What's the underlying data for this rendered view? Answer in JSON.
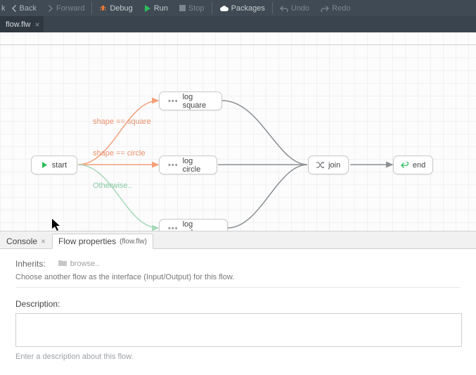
{
  "toolbar": {
    "back": "Back",
    "forward": "Forward",
    "debug": "Debug",
    "run": "Run",
    "stop": "Stop",
    "packages": "Packages",
    "undo": "Undo",
    "redo": "Redo"
  },
  "tabs": {
    "file": "flow.flw"
  },
  "nodes": {
    "start": "start",
    "log_square": "log square",
    "log_circle": "log circle",
    "log_unknown": "log unknown",
    "join": "join",
    "end": "end"
  },
  "edges": {
    "square": "shape == square",
    "circle": "shape == circle",
    "otherwise": "Otherwise.."
  },
  "panel": {
    "console": "Console",
    "flowprops": "Flow properties",
    "flowprops_sub": "(flow.flw)",
    "inherits_label": "Inherits:",
    "browse": "browse..",
    "inherits_hint": "Choose another flow as the interface (Input/Output) for this flow.",
    "description_label": "Description:",
    "description_placeholder": "Enter a description about this flow."
  }
}
